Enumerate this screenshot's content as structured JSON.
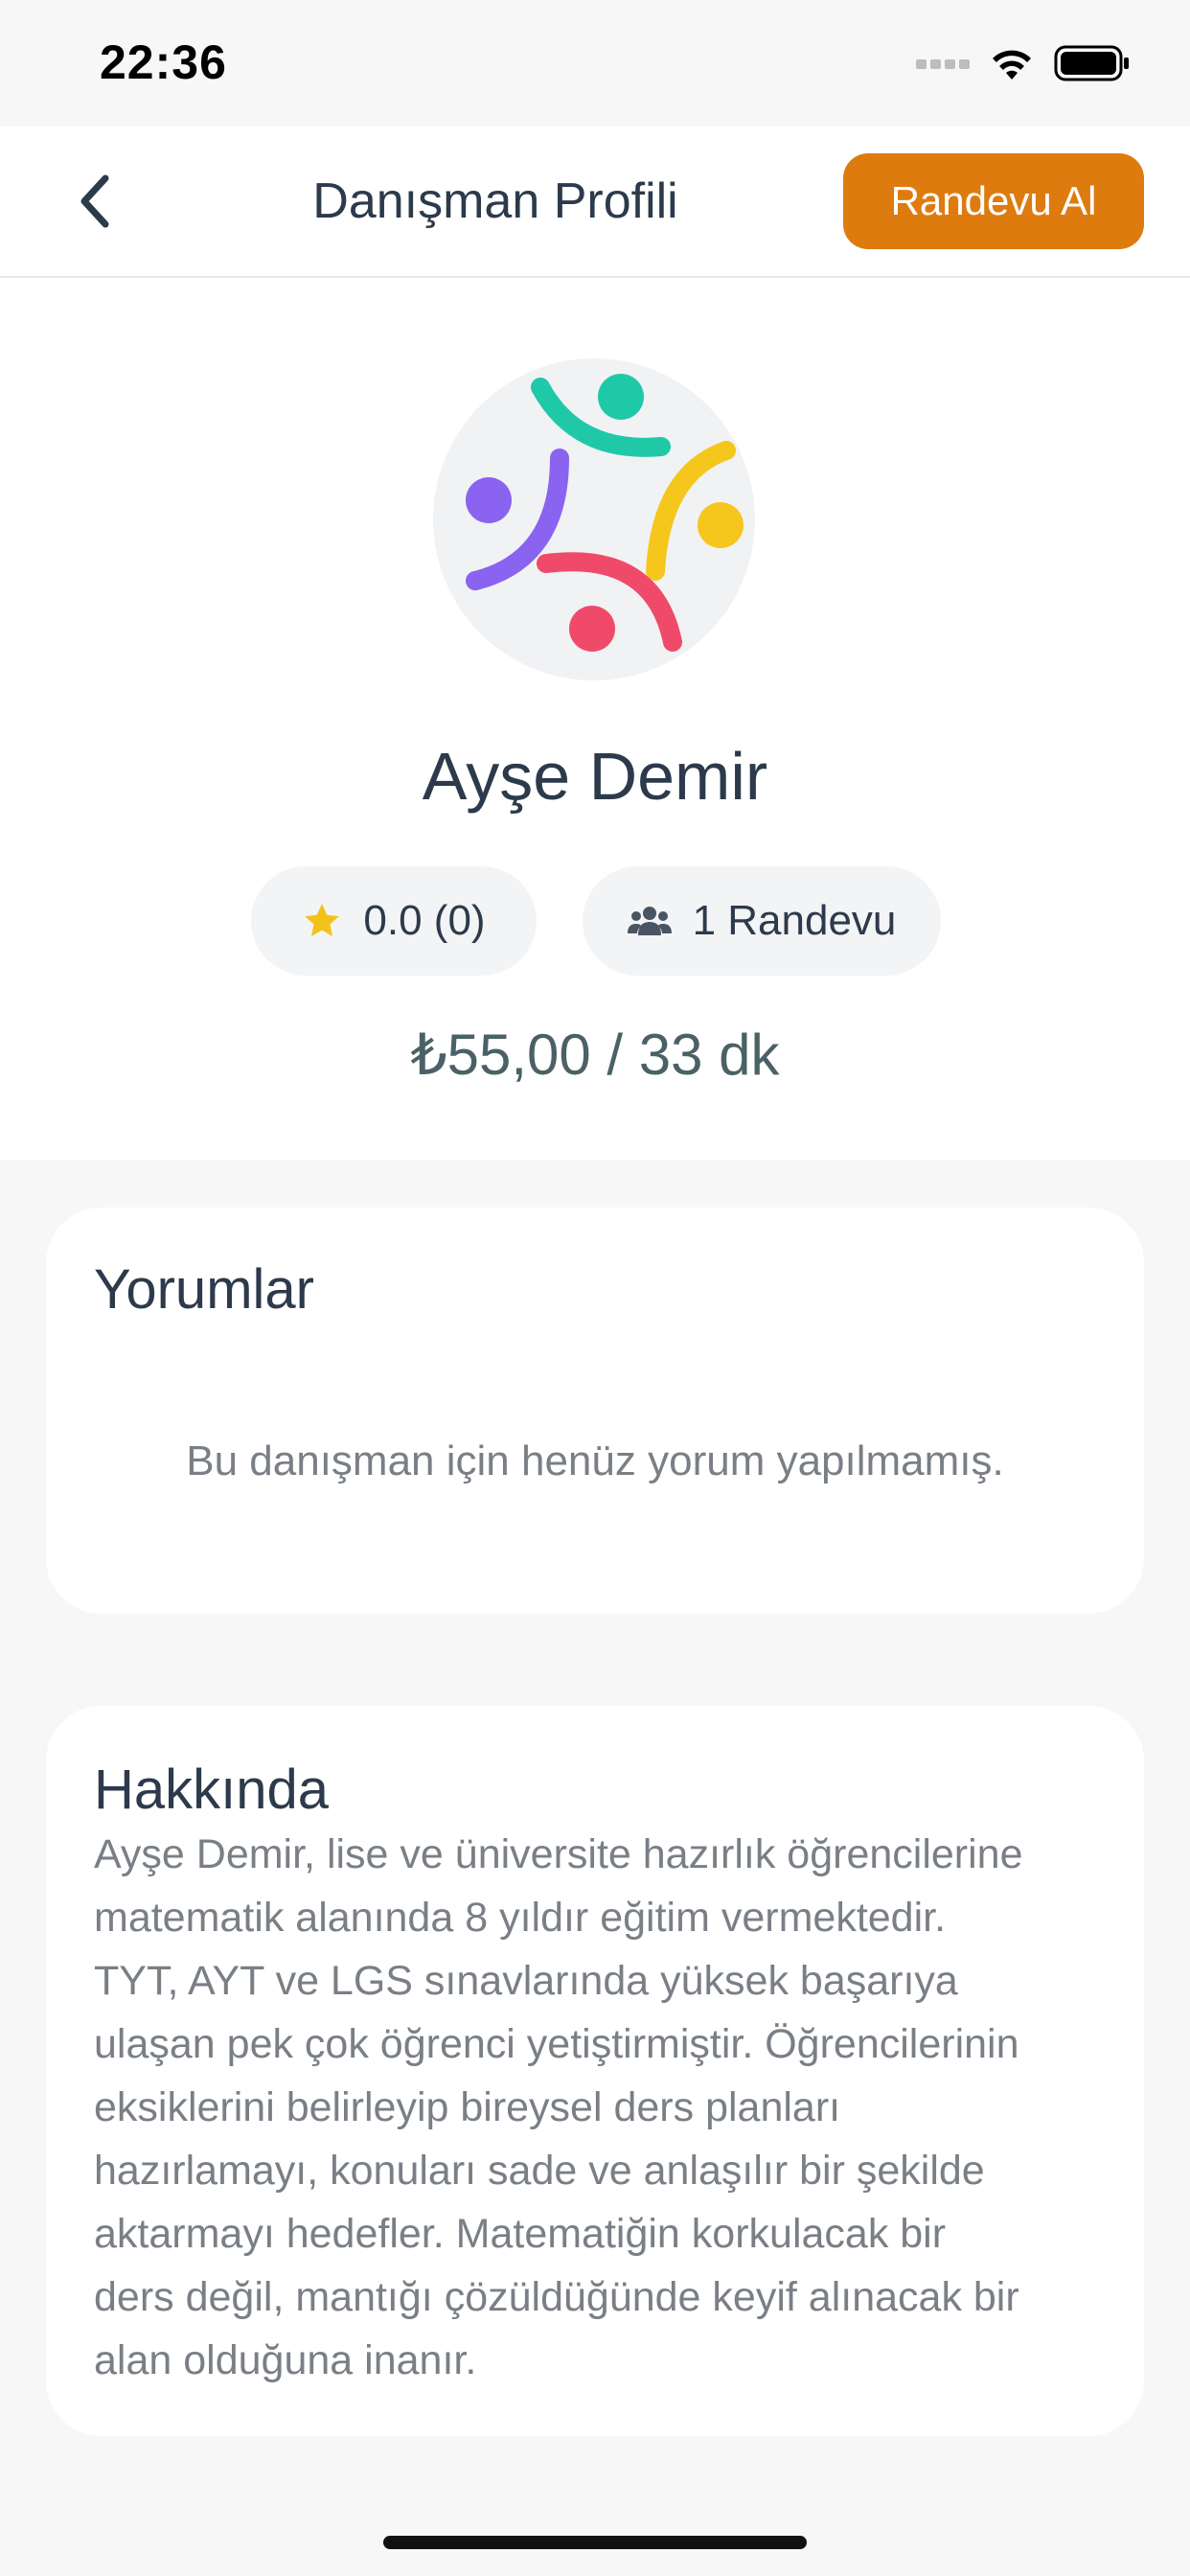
{
  "status_bar": {
    "time": "22:36"
  },
  "nav": {
    "title": "Danışman Profili",
    "cta_label": "Randevu Al",
    "back_icon": "chevron-left-icon"
  },
  "profile": {
    "name": "Ayşe Demir",
    "rating_text": "0.0 (0)",
    "appointments_text": "1 Randevu",
    "price_text": "₺55,00 / 33 dk"
  },
  "reviews": {
    "title": "Yorumlar",
    "empty_text": "Bu danışman için henüz yorum yapılmamış."
  },
  "about": {
    "title": "Hakkında",
    "lines": [
      "Ayşe Demir, lise ve üniversite hazırlık öğrencilerine",
      "matematik alanında 8 yıldır eğitim vermektedir.",
      "TYT, AYT ve LGS sınavlarında yüksek başarıya",
      "ulaşan pek çok öğrenci yetiştirmiştir. Öğrencilerinin",
      "eksiklerini belirleyip bireysel ders planları",
      "hazırlamayı, konuları sade ve anlaşılır bir şekilde",
      "aktarmayı hedefler. Matematiğin korkulacak bir",
      "ders değil, mantığı çözüldüğünde keyif alınacak bir",
      "alan olduğuna inanır."
    ]
  },
  "colors": {
    "accent": "#de7b0f",
    "star": "#f2c21b",
    "logo_teal": "#1fc9a7",
    "logo_yellow": "#f5c71d",
    "logo_purple": "#8a63f0",
    "logo_pink": "#f04a6a"
  }
}
